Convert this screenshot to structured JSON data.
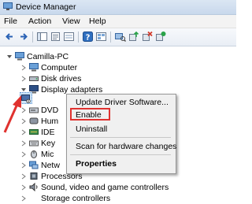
{
  "window": {
    "title": "Device Manager"
  },
  "menu": [
    "File",
    "Action",
    "View",
    "Help"
  ],
  "toolbar": {
    "icons": [
      "back-icon",
      "forward-icon",
      "console-tree-icon",
      "properties-icon",
      "help-icon",
      "show-hidden-icon",
      "scan-hardware-icon",
      "update-driver-icon",
      "uninstall-icon",
      "enable-device-icon"
    ]
  },
  "tree": {
    "root": "Camilla-PC",
    "nodes": [
      "Computer",
      "Disk drives",
      "Display adapters",
      "",
      "DVD",
      "Hum",
      "IDE",
      "Key",
      "Mic",
      "Netw",
      "Processors",
      "Sound, video and game controllers",
      "Storage controllers"
    ]
  },
  "context_menu": {
    "items": [
      "Update Driver Software...",
      "Enable",
      "Uninstall",
      "Scan for hardware changes",
      "Properties"
    ],
    "highlighted": "Enable",
    "highlight_color": "#e0322f"
  },
  "annotation": {
    "arrow_color": "#e0322f"
  }
}
